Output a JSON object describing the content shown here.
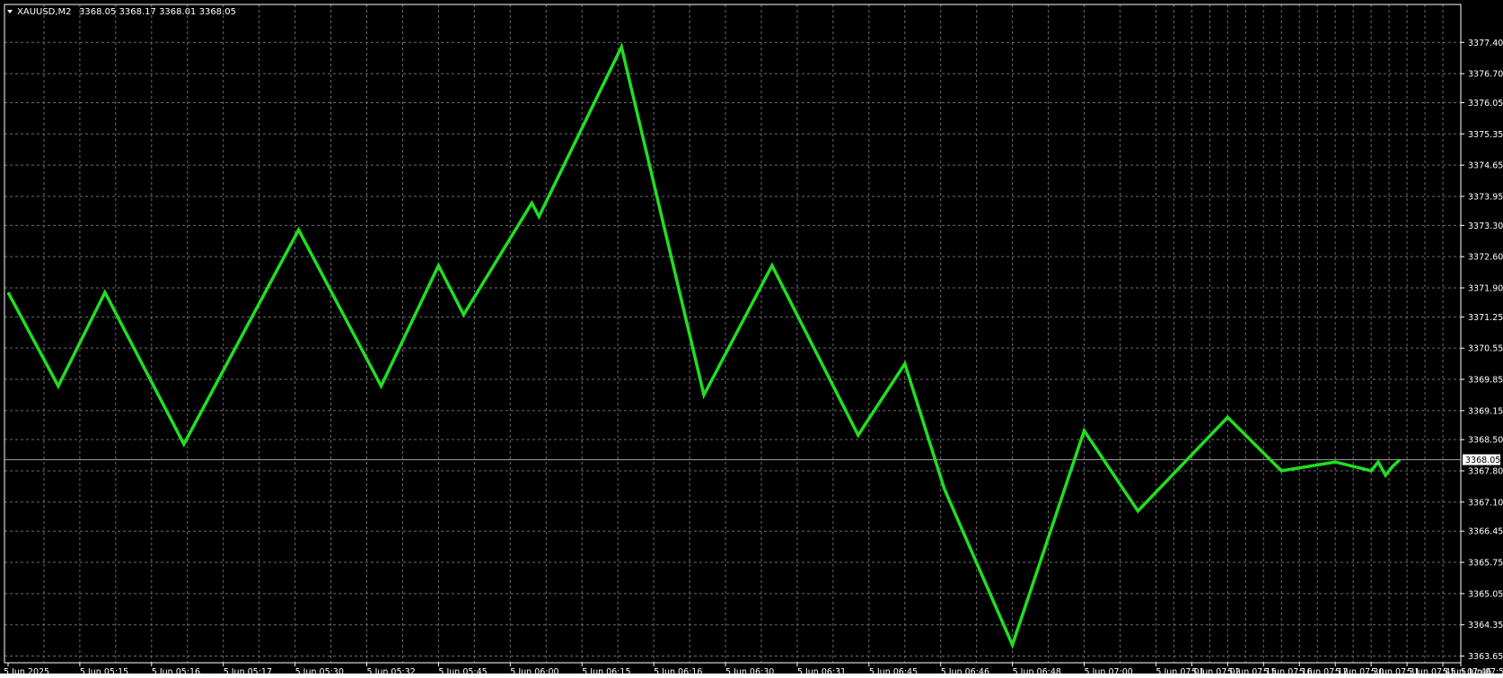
{
  "header": {
    "symbol": "XAUUSD,M2",
    "ohlc": "3368.05 3368.17 3368.01 3368.05"
  },
  "colors": {
    "background": "#000000",
    "grid": "#6b6b6b",
    "line": "#22dd22",
    "axis": "#ffffff",
    "current_price_line": "#a0a0a0",
    "current_price_label_bg": "#ffffff",
    "current_price_label_text": "#000000"
  },
  "chart_data": {
    "type": "line",
    "ylim": [
      3363.5,
      3378.25
    ],
    "y_ticks": [
      3377.4,
      3376.7,
      3376.05,
      3375.35,
      3374.65,
      3373.95,
      3373.3,
      3372.6,
      3371.9,
      3371.25,
      3370.55,
      3369.85,
      3369.15,
      3368.5,
      3367.8,
      3367.1,
      3366.45,
      3365.75,
      3365.05,
      3364.35,
      3363.65
    ],
    "y_tick_labels": [
      "3377.40",
      "3376.70",
      "3376.05",
      "3375.35",
      "3374.65",
      "3373.95",
      "3373.30",
      "3372.60",
      "3371.90",
      "3371.25",
      "3370.55",
      "3369.85",
      "3369.15",
      "3368.50",
      "3367.80",
      "3367.10",
      "3366.45",
      "3365.75",
      "3365.05",
      "3364.35",
      "3363.65"
    ],
    "x_tick_labels": [
      "5 Jun 2025",
      "5 Jun 05:15",
      "5 Jun 05:16",
      "5 Jun 05:17",
      "5 Jun 05:30",
      "5 Jun 05:32",
      "5 Jun 05:45",
      "5 Jun 06:00",
      "5 Jun 06:15",
      "5 Jun 06:16",
      "5 Jun 06:30",
      "5 Jun 06:31",
      "5 Jun 06:45",
      "5 Jun 06:46",
      "5 Jun 06:48",
      "5 Jun 07:00",
      "5 Jun 07:01",
      "5 Jun 07:02",
      "5 Jun 07:15",
      "5 Jun 07:16",
      "5 Jun 07:17",
      "5 Jun 07:30",
      "5 Jun 07:31",
      "5 Jun 07:45",
      "5 Jun 07:46",
      "5 Jun 07:56"
    ],
    "x_tick_index": [
      0,
      20,
      40,
      60,
      80,
      100,
      120,
      140,
      160,
      180,
      200,
      220,
      240,
      260,
      280,
      300,
      320,
      330,
      340,
      350,
      360,
      370,
      380,
      390,
      400,
      405
    ],
    "x_range": [
      -1,
      405
    ],
    "current_price": 3368.05,
    "current_price_label": "3368.05",
    "grid": true,
    "series": [
      {
        "x": [
          0,
          14,
          27,
          49,
          81,
          104,
          120,
          127,
          146,
          148,
          171,
          194,
          213,
          237,
          250,
          261,
          280,
          300,
          315,
          340,
          355,
          370,
          380,
          382,
          384,
          386,
          388
        ],
        "y": [
          3371.8,
          3369.7,
          3371.8,
          3368.4,
          3373.2,
          3369.7,
          3372.4,
          3371.3,
          3373.8,
          3373.5,
          3377.3,
          3369.5,
          3372.4,
          3368.6,
          3370.2,
          3367.4,
          3363.9,
          3368.7,
          3366.9,
          3369.0,
          3367.8,
          3368.0,
          3367.8,
          3368.0,
          3367.7,
          3367.9,
          3368.05
        ]
      }
    ]
  }
}
